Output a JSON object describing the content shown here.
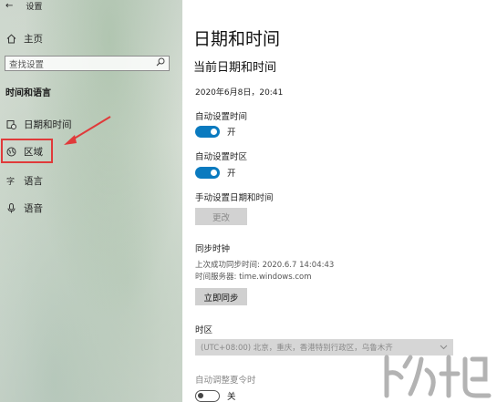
{
  "window": {
    "title": "设置"
  },
  "sidebar": {
    "home_label": "主页",
    "search_placeholder": "查找设置",
    "section_label": "时间和语言",
    "items": [
      {
        "label": "日期和时间",
        "icon": "calendar-icon"
      },
      {
        "label": "区域",
        "icon": "globe-icon"
      },
      {
        "label": "语言",
        "icon": "language-icon"
      },
      {
        "label": "语音",
        "icon": "microphone-icon"
      }
    ]
  },
  "main": {
    "title": "日期和时间",
    "subtitle": "当前日期和时间",
    "current_datetime": "2020年6月8日，20:41",
    "auto_time": {
      "label": "自动设置时间",
      "state": "开",
      "on": true
    },
    "auto_timezone": {
      "label": "自动设置时区",
      "state": "开",
      "on": true
    },
    "manual": {
      "label": "手动设置日期和时间",
      "button": "更改"
    },
    "sync": {
      "heading": "同步时钟",
      "last_sync": "上次成功同步时间: 2020.6.7 14:04:43",
      "server": "时间服务器: time.windows.com",
      "button": "立即同步"
    },
    "timezone": {
      "label": "时区",
      "value": "(UTC+08:00) 北京，重庆，香港特别行政区，乌鲁木齐"
    },
    "dst": {
      "label": "自动调整夏令时",
      "state": "关",
      "on": false
    }
  },
  "colors": {
    "accent": "#0a7abf",
    "highlight": "#e03a3a"
  }
}
